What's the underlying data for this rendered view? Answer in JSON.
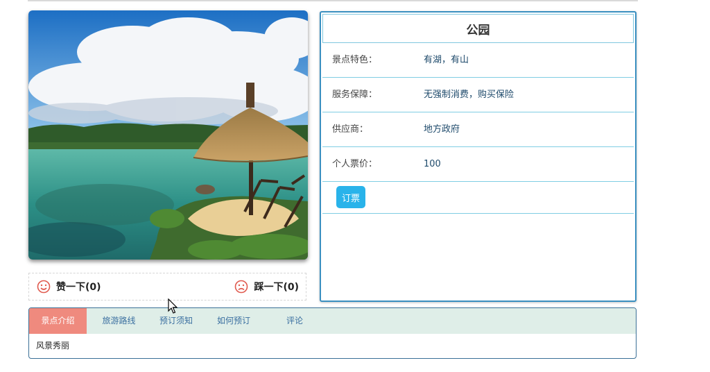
{
  "attraction": {
    "name": "公园",
    "details": [
      {
        "label": "景点特色：",
        "value": "有湖，有山"
      },
      {
        "label": "服务保障：",
        "value": "无强制消费，购买保险"
      },
      {
        "label": "供应商：",
        "value": "地方政府"
      },
      {
        "label": "个人票价：",
        "value": "100"
      }
    ],
    "book_label": "订票"
  },
  "votes": {
    "like_label": "赞一下(0)",
    "dislike_label": "踩一下(0)",
    "like_icon": "smile-icon",
    "dislike_icon": "frown-icon"
  },
  "tabs": [
    {
      "label": "景点介绍",
      "active": true
    },
    {
      "label": "旅游路线",
      "active": false
    },
    {
      "label": "预订须知",
      "active": false
    },
    {
      "label": "如何预订",
      "active": false
    },
    {
      "label": "评论",
      "active": false
    }
  ],
  "tab_content": "风景秀丽",
  "colors": {
    "panel_border": "#3a8fc0",
    "row_divider": "#7fcde3",
    "book_button": "#29b3ea",
    "active_tab": "#ef8a7e",
    "tab_bar": "#dfeee8",
    "vote_icon": "#e05a4e"
  }
}
